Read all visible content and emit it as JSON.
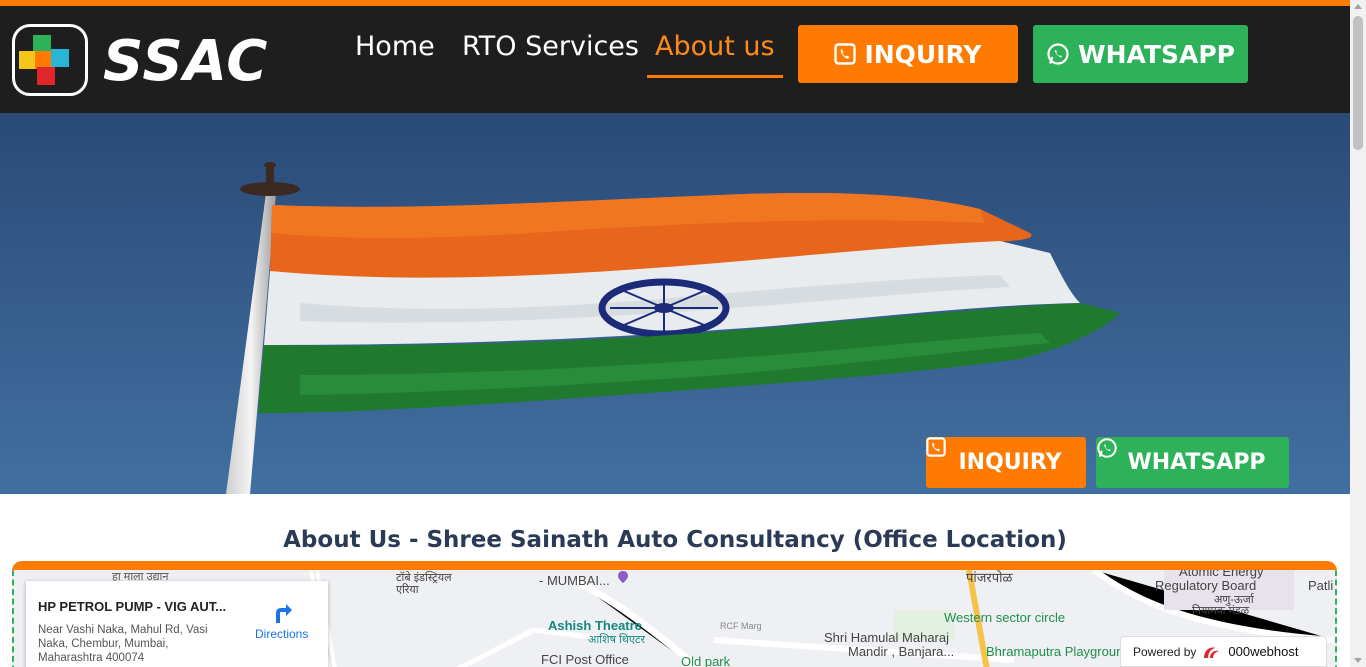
{
  "brand": {
    "logo_text": "SSAC",
    "colors": {
      "accent": "#ff7a00",
      "whatsapp": "#2db25a",
      "header_bg": "#1e1e1e",
      "title": "#2b3a55"
    }
  },
  "nav": {
    "items": [
      {
        "label": "Home",
        "active": false
      },
      {
        "label": "RTO Services",
        "active": false
      },
      {
        "label": "About us",
        "active": true
      }
    ]
  },
  "buttons": {
    "inquiry": {
      "label": "INQUIRY",
      "icon": "phone-square-icon"
    },
    "whatsapp": {
      "label": "WHATSAPP",
      "icon": "whatsapp-icon"
    }
  },
  "hero": {
    "image": "indian-flag-on-pole"
  },
  "about": {
    "title": "About Us - Shree Sainath Auto Consultancy (Office Location)"
  },
  "map": {
    "place_name": "HP PETROL PUMP - VIG AUT...",
    "place_address": "Near Vashi Naka, Mahul Rd, Vasi Naka, Chembur, Mumbai, Maharashtra 400074",
    "directions_label": "Directions",
    "labels": {
      "mumbai": "- MUMBAI...",
      "industrial_area": "टॉबे इंडस्ट्रियल एरिया",
      "ashish_theatre": "Ashish Theatre",
      "ashish_theatre_hi": "आशिष थिएटर",
      "rcf_marg": "RCF Marg",
      "fci_post_office": "FCI Post Office",
      "old_park": "Old park",
      "shri_hamulal": "Shri Hamulal Maharaj",
      "mandir": "Mandir , Banjara...",
      "western_sector": "Western sector circle",
      "brahmaputra": "Bhramaputra Playground",
      "atomic_energy": "Atomic Energy",
      "regulatory_board": "Regulatory Board",
      "atomic_hi": "अणु-ऊर्जा",
      "niyamak": "नियामक मंडळ",
      "patli": "Patli",
      "panjarpol": "पांजरपोळ",
      "hi_mali": "हा माला उद्यान"
    }
  },
  "powered_by": {
    "prefix": "Powered by",
    "brand": "000webhost"
  }
}
